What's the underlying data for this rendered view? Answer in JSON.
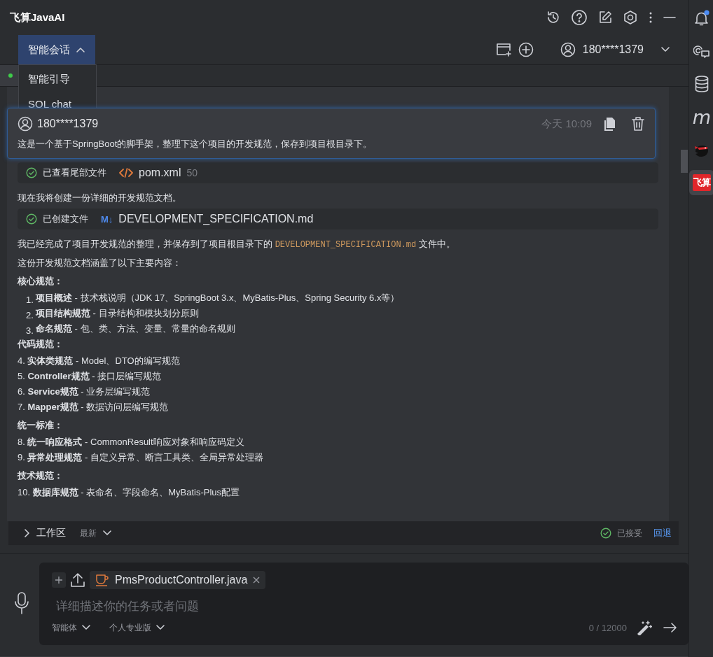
{
  "app": {
    "title": "飞算JavaAI"
  },
  "mode_button": {
    "label": "智能会话",
    "expanded": true
  },
  "mode_menu": [
    {
      "label": "智能引导"
    },
    {
      "label": "SQL chat"
    }
  ],
  "account": {
    "name": "180****1379"
  },
  "user_message": {
    "name": "180****1379",
    "time": "今天 10:09",
    "text": "这是一个基于SpringBoot的脚手架，整理下这个项目的开发规范，保存到项目根目录下。"
  },
  "reply": [
    {
      "kind": "tool",
      "status": "已查看尾部文件",
      "file": "pom.xml",
      "count": "50"
    },
    {
      "kind": "text",
      "segments": [
        {
          "text": "现在我将创建一份详细的开发规范文档。"
        }
      ]
    },
    {
      "kind": "tool",
      "status": "已创建文件",
      "badge": "M↓",
      "file": "DEVELOPMENT_SPECIFICATION.md"
    },
    {
      "kind": "text",
      "segments": [
        {
          "text": "我已经完成了项目开发规范的整理，并保存到了项目根目录下的 "
        },
        {
          "text": "DEVELOPMENT_SPECIFICATION.md",
          "code": true
        },
        {
          "text": " 文件中。"
        }
      ]
    },
    {
      "kind": "text",
      "segments": [
        {
          "text": "这份开发规范文档涵盖了以下主要内容："
        }
      ]
    },
    {
      "kind": "heading",
      "text": "核心规范："
    },
    {
      "kind": "item",
      "number": "1.",
      "text": "**项目概述** - 技术栈说明（JDK 17、SpringBoot 3.x、MyBatis-Plus、Spring Security 6.x等）"
    },
    {
      "kind": "item",
      "number": "2.",
      "text": "**项目结构规范** - 目录结构和模块划分原则"
    },
    {
      "kind": "item",
      "number": "3.",
      "text": "**命名规范** - 包、类、方法、变量、常量的命名规则"
    },
    {
      "kind": "heading",
      "text": "代码规范："
    },
    {
      "kind": "line",
      "text": "4. **实体类规范** - Model、DTO的编写规范"
    },
    {
      "kind": "line",
      "text": "5. **Controller规范** - 接口层编写规范"
    },
    {
      "kind": "line",
      "text": "6. **Service规范** - 业务层编写规范"
    },
    {
      "kind": "line",
      "text": "7. **Mapper规范** - 数据访问层编写规范"
    },
    {
      "kind": "heading",
      "text": "统一标准："
    },
    {
      "kind": "line",
      "text": "8. **统一响应格式** - CommonResult响应对象和响应码定义"
    },
    {
      "kind": "line",
      "text": "9. **异常处理规范** - 自定义异常、断言工具类、全局异常处理器"
    },
    {
      "kind": "heading",
      "text": "技术规范："
    },
    {
      "kind": "line",
      "text": "10. **数据库规范** - 表命名、字段命名、MyBatis-Plus配置"
    }
  ],
  "workspace": {
    "label": "工作区",
    "filter": "最新",
    "status": "已接受",
    "action": "回退",
    "expanded": false
  },
  "composer": {
    "attachments": [
      {
        "name": "PmsProductController.java"
      }
    ],
    "placeholder": "详细描述你的任务或者问题",
    "agent": "智能体",
    "plan": "个人专业版",
    "counter": "0 / 12000"
  },
  "sidebar": [
    {
      "kind": "bell",
      "badge": true,
      "selected": false
    },
    {
      "kind": "chat",
      "selected": false
    },
    {
      "kind": "database",
      "selected": false
    },
    {
      "kind": "letter",
      "label": "m",
      "selected": false
    },
    {
      "kind": "bird",
      "selected": false
    },
    {
      "kind": "logo",
      "label": "飞算",
      "selected": true
    }
  ]
}
